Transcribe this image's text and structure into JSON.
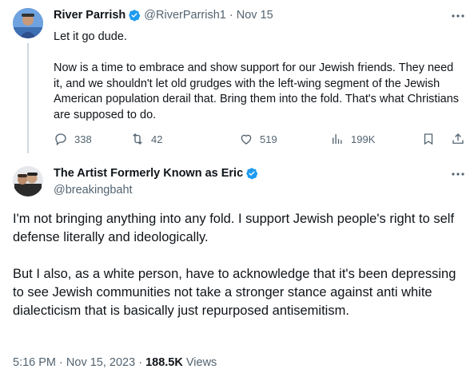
{
  "colors": {
    "verified": "#1d9bf0",
    "text": "#0f1419",
    "secondary": "#536471",
    "thread_line": "#cfd9de"
  },
  "tweet1": {
    "name": "River Parrish",
    "handle": "@RiverParrish1",
    "separator": "·",
    "date": "Nov 15",
    "paragraphs": [
      "Let it go dude.",
      "Now is a time to embrace and show support for our Jewish friends.  They need it, and we shouldn't let old grudges with the left-wing segment of the Jewish American population derail that.  Bring them into the fold.  That's what Christians are supposed to do."
    ],
    "replies": "338",
    "retweets": "42",
    "likes": "519",
    "views": "199K",
    "icons": [
      "reply-icon",
      "retweet-icon",
      "like-icon",
      "views-icon",
      "bookmark-icon",
      "share-icon",
      "more-icon",
      "verified-icon"
    ]
  },
  "tweet2": {
    "name": "The Artist Formerly Known as Eric",
    "handle": "@breakingbaht",
    "paragraphs": [
      "I'm not bringing anything into any fold. I support Jewish people's right to self defense literally and ideologically.",
      "But I also, as a white person, have to acknowledge that it's been depressing to see Jewish communities not take a stronger stance against anti white dialecticism that is basically just repurposed antisemitism."
    ],
    "time": "5:16 PM",
    "date": "Nov 15, 2023",
    "views_count": "188.5K",
    "views_label": "Views",
    "separator": "·"
  }
}
